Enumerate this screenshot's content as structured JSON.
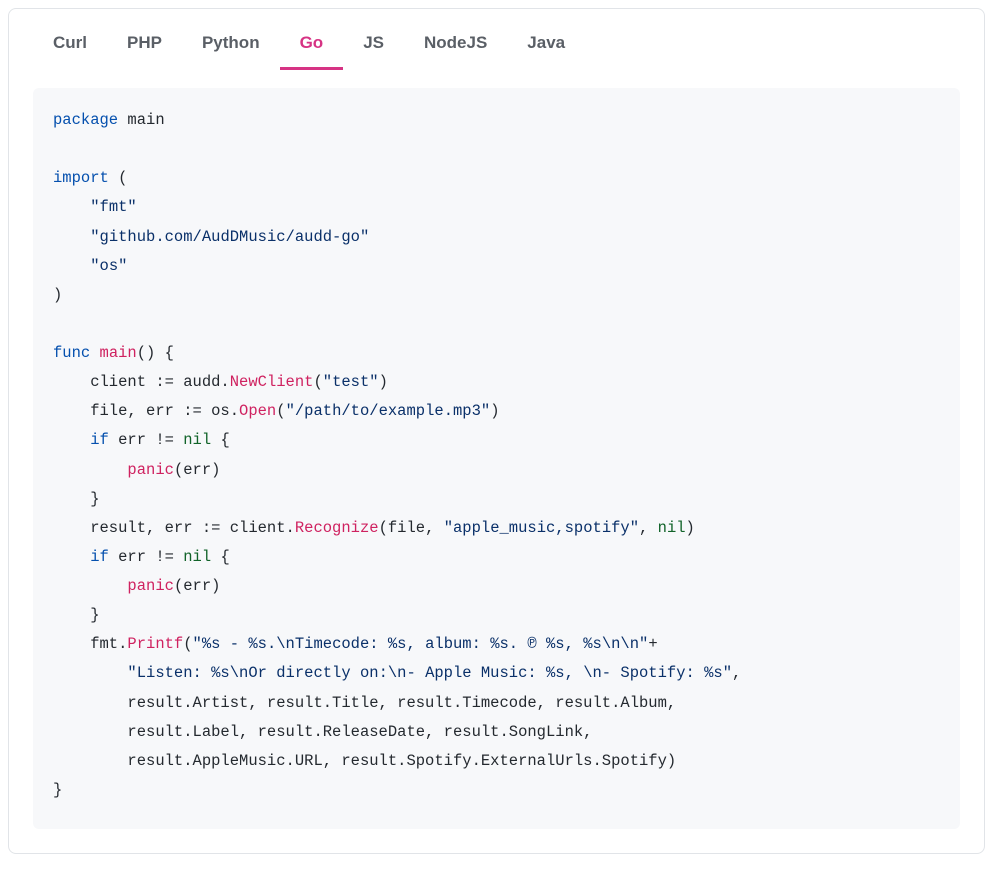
{
  "tabs": [
    {
      "label": "Curl",
      "active": false
    },
    {
      "label": "PHP",
      "active": false
    },
    {
      "label": "Python",
      "active": false
    },
    {
      "label": "Go",
      "active": true
    },
    {
      "label": "JS",
      "active": false
    },
    {
      "label": "NodeJS",
      "active": false
    },
    {
      "label": "Java",
      "active": false
    }
  ],
  "code": {
    "language": "go",
    "tokens": [
      [
        "kw",
        "package"
      ],
      [
        "plain",
        " main"
      ],
      [
        "nl"
      ],
      [
        "nl"
      ],
      [
        "kw",
        "import"
      ],
      [
        "plain",
        " ("
      ],
      [
        "nl"
      ],
      [
        "plain",
        "    "
      ],
      [
        "str",
        "\"fmt\""
      ],
      [
        "nl"
      ],
      [
        "plain",
        "    "
      ],
      [
        "str",
        "\"github.com/AudDMusic/audd-go\""
      ],
      [
        "nl"
      ],
      [
        "plain",
        "    "
      ],
      [
        "str",
        "\"os\""
      ],
      [
        "nl"
      ],
      [
        "plain",
        ")"
      ],
      [
        "nl"
      ],
      [
        "nl"
      ],
      [
        "kw",
        "func"
      ],
      [
        "plain",
        " "
      ],
      [
        "fn",
        "main"
      ],
      [
        "plain",
        "() {"
      ],
      [
        "nl"
      ],
      [
        "plain",
        "    client := audd."
      ],
      [
        "fn",
        "NewClient"
      ],
      [
        "plain",
        "("
      ],
      [
        "str",
        "\"test\""
      ],
      [
        "plain",
        ")"
      ],
      [
        "nl"
      ],
      [
        "plain",
        "    file, err := os."
      ],
      [
        "fn",
        "Open"
      ],
      [
        "plain",
        "("
      ],
      [
        "str",
        "\"/path/to/example.mp3\""
      ],
      [
        "plain",
        ")"
      ],
      [
        "nl"
      ],
      [
        "plain",
        "    "
      ],
      [
        "kw",
        "if"
      ],
      [
        "plain",
        " err != "
      ],
      [
        "builtin",
        "nil"
      ],
      [
        "plain",
        " {"
      ],
      [
        "nl"
      ],
      [
        "plain",
        "        "
      ],
      [
        "fn",
        "panic"
      ],
      [
        "plain",
        "(err)"
      ],
      [
        "nl"
      ],
      [
        "plain",
        "    }"
      ],
      [
        "nl"
      ],
      [
        "plain",
        "    result, err := client."
      ],
      [
        "fn",
        "Recognize"
      ],
      [
        "plain",
        "(file, "
      ],
      [
        "str",
        "\"apple_music,spotify\""
      ],
      [
        "plain",
        ", "
      ],
      [
        "builtin",
        "nil"
      ],
      [
        "plain",
        ")"
      ],
      [
        "nl"
      ],
      [
        "plain",
        "    "
      ],
      [
        "kw",
        "if"
      ],
      [
        "plain",
        " err != "
      ],
      [
        "builtin",
        "nil"
      ],
      [
        "plain",
        " {"
      ],
      [
        "nl"
      ],
      [
        "plain",
        "        "
      ],
      [
        "fn",
        "panic"
      ],
      [
        "plain",
        "(err)"
      ],
      [
        "nl"
      ],
      [
        "plain",
        "    }"
      ],
      [
        "nl"
      ],
      [
        "plain",
        "    fmt."
      ],
      [
        "fn",
        "Printf"
      ],
      [
        "plain",
        "("
      ],
      [
        "str",
        "\"%s - %s.\\nTimecode: %s, album: %s. ℗ %s, %s\\n\\n\""
      ],
      [
        "plain",
        "+"
      ],
      [
        "nl"
      ],
      [
        "plain",
        "        "
      ],
      [
        "str",
        "\"Listen: %s\\nOr directly on:\\n- Apple Music: %s, \\n- Spotify: %s\""
      ],
      [
        "plain",
        ","
      ],
      [
        "nl"
      ],
      [
        "plain",
        "        result.Artist, result.Title, result.Timecode, result.Album,"
      ],
      [
        "nl"
      ],
      [
        "plain",
        "        result.Label, result.ReleaseDate, result.SongLink,"
      ],
      [
        "nl"
      ],
      [
        "plain",
        "        result.AppleMusic.URL, result.Spotify.ExternalUrls.Spotify)"
      ],
      [
        "nl"
      ],
      [
        "plain",
        "}"
      ]
    ]
  }
}
